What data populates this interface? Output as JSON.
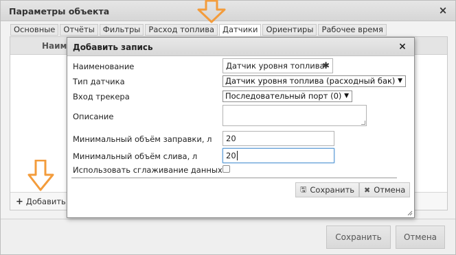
{
  "window": {
    "title": "Параметры объекта",
    "close_icon": "×"
  },
  "tabs": [
    {
      "label": "Основные"
    },
    {
      "label": "Отчёты"
    },
    {
      "label": "Фильтры"
    },
    {
      "label": "Расход топлива"
    },
    {
      "label": "Датчики",
      "active": true
    },
    {
      "label": "Ориентиры"
    },
    {
      "label": "Рабочее время"
    }
  ],
  "grid": {
    "column_name": "Наиме",
    "add_label": "Добавить",
    "add_icon": "+"
  },
  "footer": {
    "save_label": "Сохранить",
    "cancel_label": "Отмена"
  },
  "modal": {
    "title": "Добавить запись",
    "close_icon": "×",
    "fields": {
      "name_label": "Наименование",
      "name_value": "Датчик уровня топлива",
      "required_icon": "✱",
      "sensor_type_label": "Тип датчика",
      "sensor_type_value": "Датчик уровня топлива (расходный бак)",
      "tracker_input_label": "Вход трекера",
      "tracker_input_value": "Последовательный порт (0)",
      "description_label": "Описание",
      "description_value": "",
      "min_refuel_label": "Минимальный объём заправки, л",
      "min_refuel_value": "20",
      "min_drain_label": "Минимальный объём слива, л",
      "min_drain_value": "20",
      "smoothing_label": "Использовать сглаживание данных",
      "smoothing_checked": false
    },
    "save_label": "Сохранить",
    "cancel_label": "Отмена"
  },
  "colors": {
    "annotation_arrow": "#f39c3c",
    "focus_border": "#5b9bd5"
  }
}
